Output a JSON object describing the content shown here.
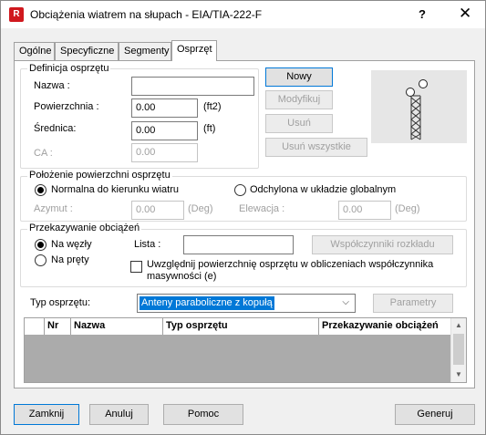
{
  "window": {
    "title": "Obciążenia wiatrem na słupach - EIA/TIA-222-F",
    "app_icon": "R",
    "help": "?",
    "close": "✕"
  },
  "tabs": [
    "Ogólne",
    "Specyficzne",
    "Segmenty",
    "Osprzęt"
  ],
  "active_tab": "Osprzęt",
  "definition": {
    "legend": "Definicja osprzętu",
    "name_label": "Nazwa :",
    "name_value": "",
    "surface_label": "Powierzchnia :",
    "surface_value": "0.00",
    "surface_unit": "(ft2)",
    "diameter_label": "Średnica:",
    "diameter_value": "0.00",
    "diameter_unit": "(ft)",
    "ca_label": "CA :",
    "ca_value": "0.00"
  },
  "action_buttons": {
    "new": "Nowy",
    "modify": "Modyfikuj",
    "delete": "Usuń",
    "delete_all": "Usuń wszystkie"
  },
  "position": {
    "legend": "Położenie powierzchni osprzętu",
    "normal_label": "Normalna do kierunku wiatru",
    "normal_selected": true,
    "deviated_label": "Odchylona w układzie globalnym",
    "azimuth_label": "Azymut :",
    "azimuth_value": "0.00",
    "azimuth_unit": "(Deg)",
    "elevation_label": "Elewacja :",
    "elevation_value": "0.00",
    "elevation_unit": "(Deg)"
  },
  "load_transfer": {
    "legend": "Przekazywanie obciążeń",
    "nodes_label": "Na węzły",
    "nodes_selected": true,
    "bars_label": "Na pręty",
    "list_label": "Lista :",
    "list_value": "",
    "coeff_button": "Współczynniki rozkładu",
    "include_surface_label": "Uwzględnij powierzchnię osprzętu w obliczeniach współczynnika masywności (e)",
    "include_surface_checked": false
  },
  "equipment_type": {
    "label": "Typ osprzętu:",
    "selected": "Anteny paraboliczne z kopułą",
    "params_button": "Parametry"
  },
  "table": {
    "columns": [
      "",
      "Nr",
      "Nazwa",
      "Typ osprzętu",
      "Przekazywanie obciążeń"
    ],
    "rows": []
  },
  "footer": {
    "close": "Zamknij",
    "cancel": "Anuluj",
    "help": "Pomoc",
    "generate": "Generuj"
  },
  "colors": {
    "accent": "#0078d7",
    "disabled_text": "#a0a0a0",
    "app_icon": "#d0181e"
  }
}
